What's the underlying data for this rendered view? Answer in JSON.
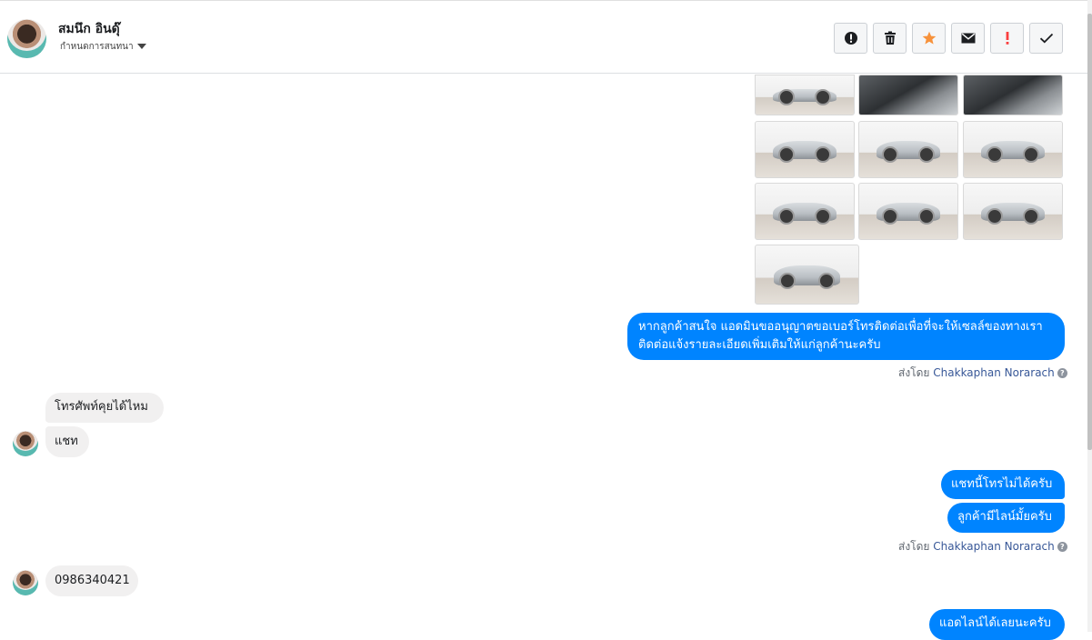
{
  "header": {
    "user_name": "สมนึก อินดุ๊",
    "subtitle": "กำหนดการสนทนา",
    "actions": [
      {
        "icon": "alert-circle-icon"
      },
      {
        "icon": "trash-icon"
      },
      {
        "icon": "star-icon",
        "color": "#f7923b"
      },
      {
        "icon": "envelope-icon"
      },
      {
        "icon": "exclamation-icon",
        "color": "#fa3e3e"
      },
      {
        "icon": "checkmark-icon"
      }
    ]
  },
  "colors": {
    "outgoing_bubble": "#0084ff",
    "incoming_bubble": "#f1f0f0",
    "link_name": "#385898"
  },
  "messages": {
    "out1": "หากลูกค้าสนใจ แอดมินขออนุญาตขอเบอร์โทรติดต่อเพื่อที่จะให้เซลล์ของทางเรา ติดต่อแจ้งรายละเอียดเพิ่มเติมให้แก่ลูกค้านะครับ",
    "sent_by_1_prefix": "ส่งโดย",
    "sent_by_1_name": "Chakkaphan Norarach",
    "in1": "โทรศัพท์คุยได้ไหม",
    "in2": "แชท",
    "out2": "แชทนี้โทรไม่ได้ครับ",
    "out3": "ลูกค้ามีไลน์มั้ยครับ",
    "sent_by_2_prefix": "ส่งโดย",
    "sent_by_2_name": "Chakkaphan Norarach",
    "in3": "0986340421",
    "out4_partial": "แอดไลน์ได้เลยนะครับ"
  }
}
